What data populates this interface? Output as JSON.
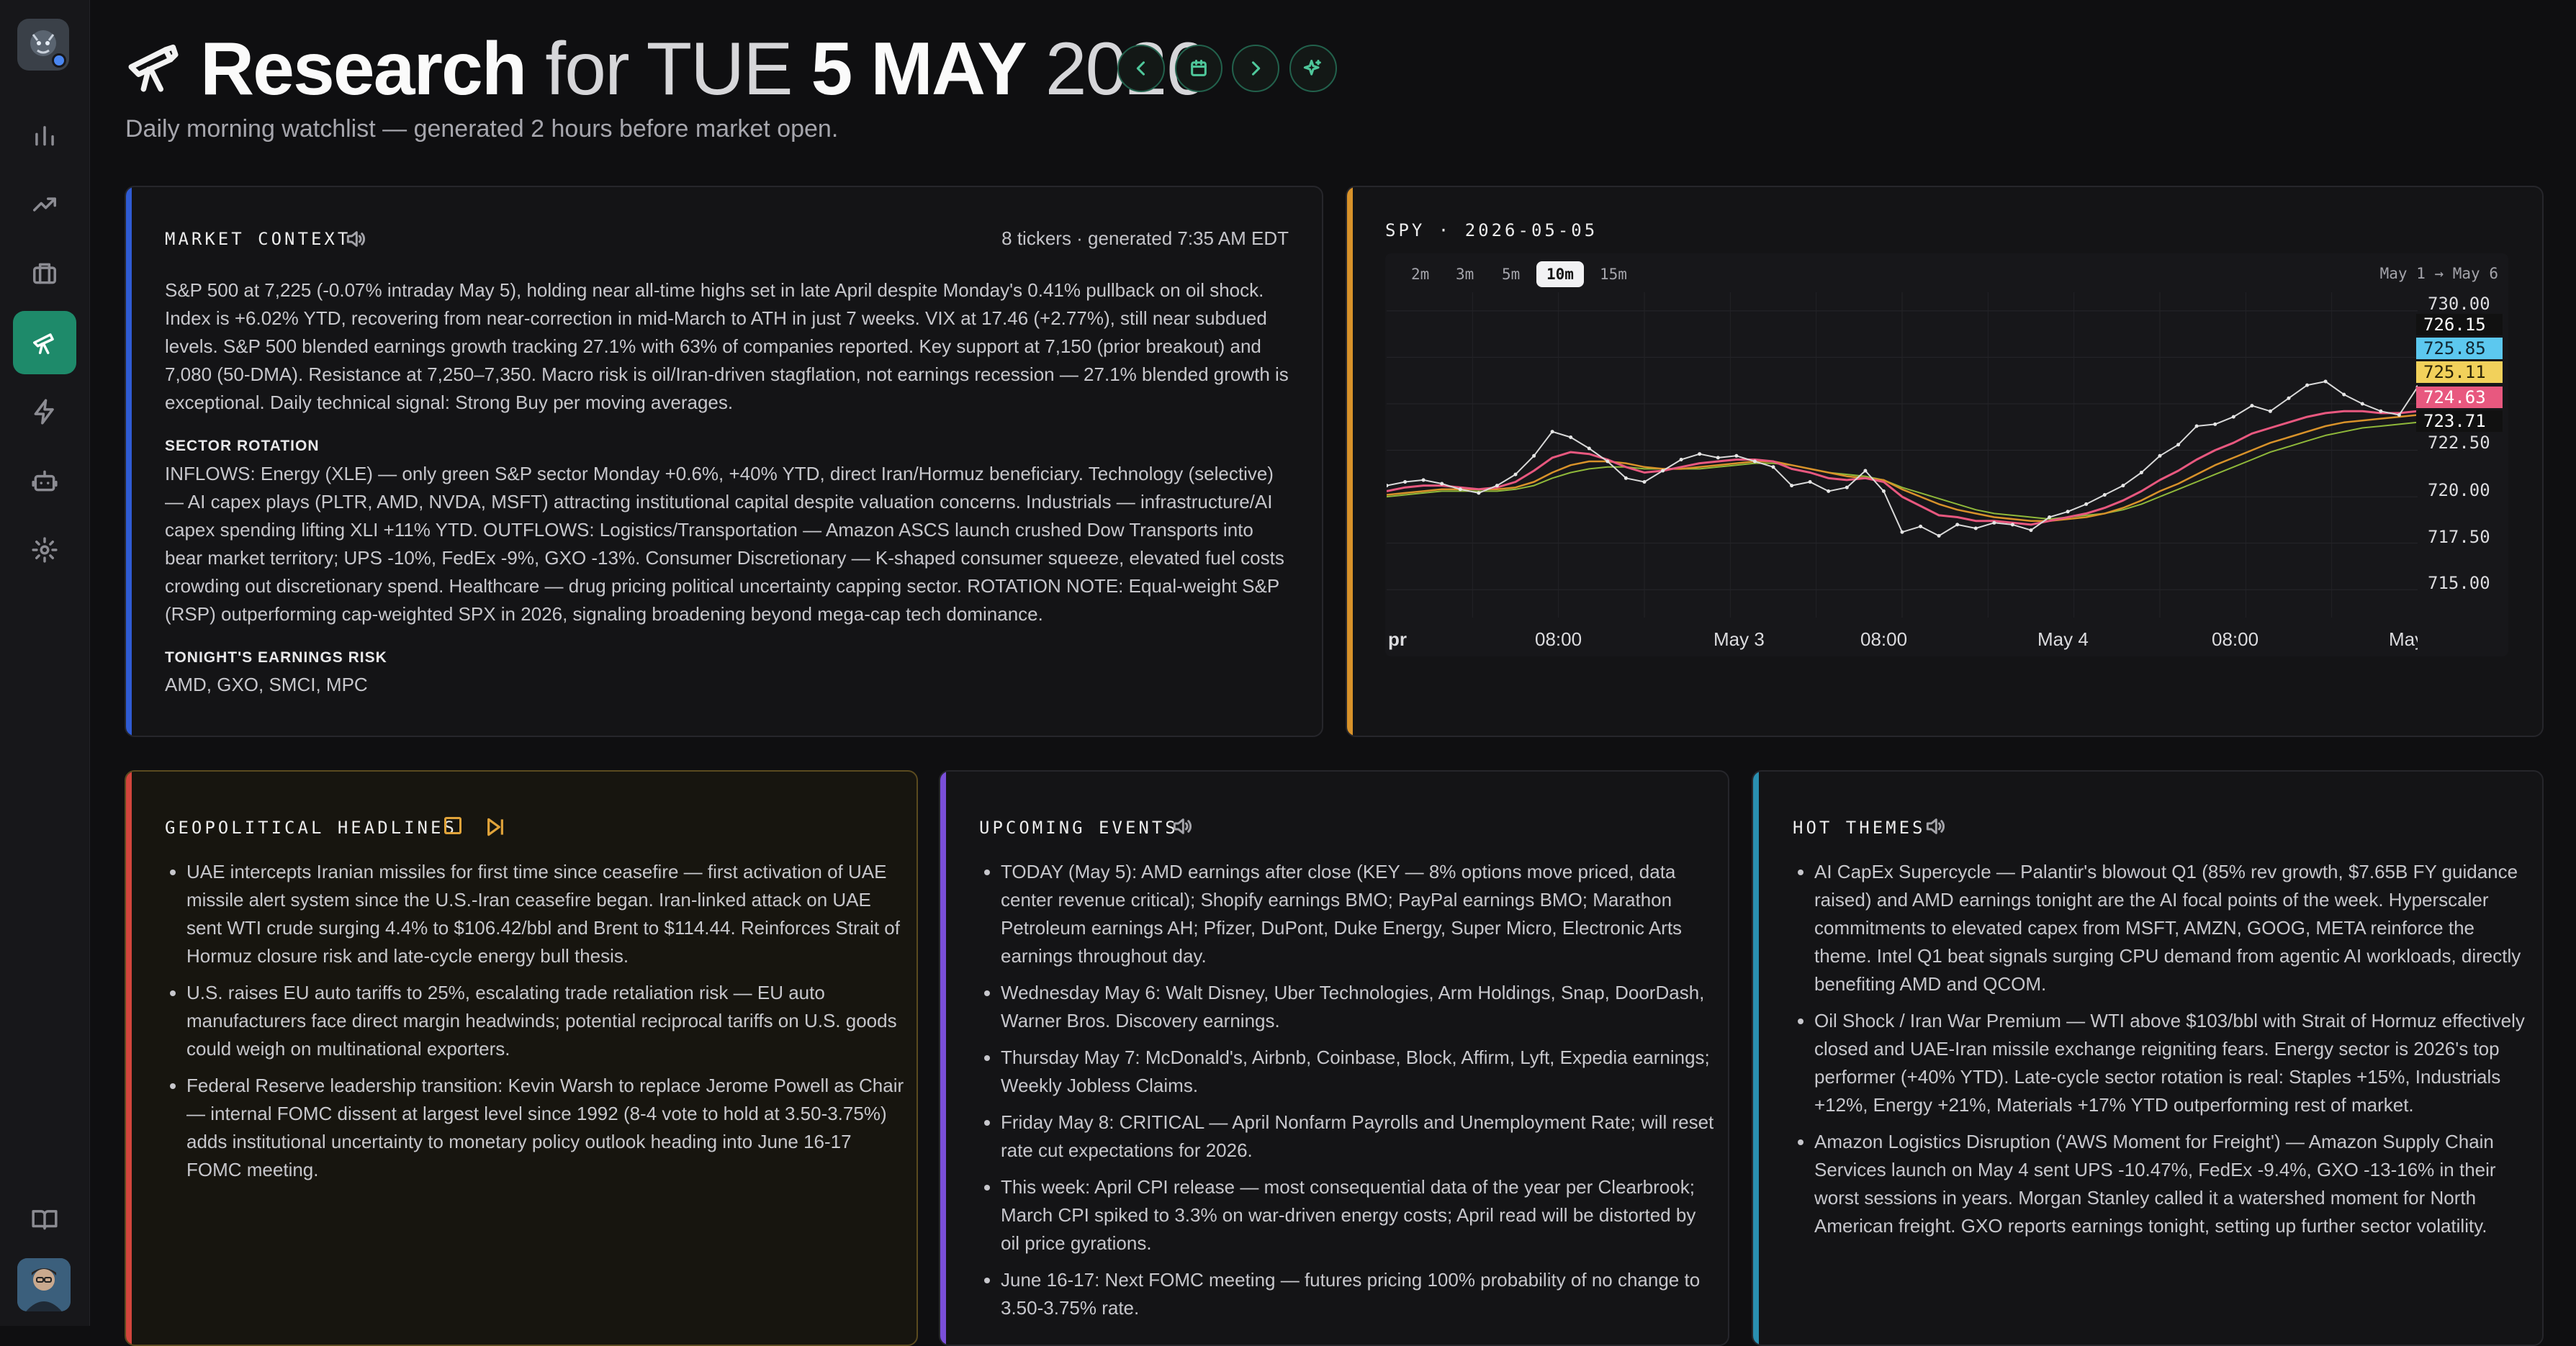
{
  "header": {
    "title_main": "Research",
    "title_for": "for",
    "date_dow": "TUE",
    "date_day_month": "5 MAY",
    "date_year": "2026",
    "subtitle": "Daily morning watchlist — generated 2 hours before market open."
  },
  "market_context": {
    "title": "MARKET CONTEXT",
    "meta": "8 tickers · generated 7:35 AM EDT",
    "body": "S&P 500 at 7,225 (-0.07% intraday May 5), holding near all-time highs set in late April despite Monday's 0.41% pullback on oil shock. Index is +6.02% YTD, recovering from near-correction in mid-March to ATH in just 7 weeks. VIX at 17.46 (+2.77%), still near subdued levels. S&P 500 blended earnings growth tracking 27.1% with 63% of companies reported. Key support at 7,150 (prior breakout) and 7,080 (50-DMA). Resistance at 7,250–7,350. Macro risk is oil/Iran-driven stagflation, not earnings recession — 27.1% blended growth is exceptional. Daily technical signal: Strong Buy per moving averages.",
    "sector_heading": "SECTOR ROTATION",
    "sector_body": "INFLOWS: Energy (XLE) — only green S&P sector Monday +0.6%, +40% YTD, direct Iran/Hormuz beneficiary. Technology (selective) — AI capex plays (PLTR, AMD, NVDA, MSFT) attracting institutional capital despite valuation concerns. Industrials — infrastructure/AI capex spending lifting XLI +11% YTD. OUTFLOWS: Logistics/Transportation — Amazon ASCS launch crushed Dow Transports into bear market territory; UPS -10%, FedEx -9%, GXO -13%. Consumer Discretionary — K-shaped consumer squeeze, elevated fuel costs crowding out discretionary spend. Healthcare — drug pricing political uncertainty capping sector. ROTATION NOTE: Equal-weight S&P (RSP) outperforming cap-weighted SPX in 2026, signaling broadening beyond mega-cap tech dominance.",
    "earnings_heading": "TONIGHT'S EARNINGS RISK",
    "earnings_body": "AMD, GXO, SMCI, MPC"
  },
  "chart_panel": {
    "title": "SPY · 2026-05-05",
    "timeframes": [
      "2m",
      "3m",
      "5m",
      "10m",
      "15m"
    ],
    "active_timeframe": "10m",
    "range_label": "May 1 → May 6"
  },
  "chart_data": {
    "type": "line",
    "symbol": "SPY",
    "x_ticks": [
      "pr",
      "08:00",
      "May 3",
      "08:00",
      "May 4",
      "08:00",
      "May"
    ],
    "y_ticks": [
      "730.00",
      "722.50",
      "720.00",
      "717.50",
      "715.00"
    ],
    "ylim": [
      713.5,
      731
    ],
    "price_labels": [
      {
        "value": "726.15",
        "color": "#111111"
      },
      {
        "value": "725.85",
        "color": "#5cc8ef"
      },
      {
        "value": "725.11",
        "color": "#f2d15b"
      },
      {
        "value": "724.63",
        "color": "#e8587f"
      },
      {
        "value": "723.71",
        "color": "#111111"
      }
    ],
    "series": [
      {
        "values": [
          720.6,
          720.8,
          720.9,
          720.7,
          720.4,
          720.2,
          720.6,
          721.2,
          722.2,
          723.5,
          723.2,
          722.6,
          721.9,
          721.0,
          720.8,
          721.4,
          722.0,
          722.3,
          722.1,
          722.2,
          721.9,
          721.6,
          720.6,
          720.8,
          720.3,
          720.5,
          721.4,
          720.3,
          718.1,
          718.4,
          717.9,
          718.5,
          718.3,
          718.6,
          718.5,
          718.2,
          718.9,
          719.2,
          719.6,
          720.1,
          720.6,
          721.3,
          722.2,
          722.8,
          723.8,
          723.9,
          724.3,
          724.9,
          724.6,
          725.3,
          726.0,
          726.2,
          725.5,
          725.0,
          724.6,
          724.4,
          725.9
        ]
      },
      {
        "values": [
          720.3,
          720.5,
          720.6,
          720.6,
          720.5,
          720.4,
          720.5,
          720.8,
          721.4,
          722.1,
          722.4,
          722.3,
          722.0,
          721.6,
          721.3,
          721.4,
          721.6,
          721.8,
          721.9,
          722.0,
          722.0,
          721.9,
          721.5,
          721.3,
          721.0,
          720.9,
          721.0,
          720.8,
          720.0,
          719.5,
          719.0,
          718.9,
          718.7,
          718.7,
          718.6,
          718.5,
          718.7,
          718.9,
          719.1,
          719.4,
          719.8,
          720.3,
          720.9,
          721.4,
          722.0,
          722.5,
          722.9,
          723.4,
          723.7,
          724.0,
          724.3,
          724.5,
          724.6,
          724.6,
          724.5,
          724.5,
          724.6
        ]
      },
      {
        "values": [
          720.1,
          720.2,
          720.3,
          720.4,
          720.4,
          720.4,
          720.4,
          720.5,
          720.8,
          721.3,
          721.7,
          721.9,
          721.9,
          721.8,
          721.6,
          721.5,
          721.5,
          721.6,
          721.7,
          721.8,
          721.9,
          721.9,
          721.7,
          721.5,
          721.3,
          721.1,
          721.0,
          720.9,
          720.4,
          720.0,
          719.6,
          719.3,
          719.1,
          718.9,
          718.8,
          718.7,
          718.7,
          718.8,
          718.9,
          719.1,
          719.4,
          719.8,
          720.3,
          720.7,
          721.2,
          721.7,
          722.1,
          722.5,
          722.9,
          723.2,
          723.5,
          723.8,
          724.0,
          724.1,
          724.2,
          724.3,
          724.4
        ]
      },
      {
        "values": [
          720.0,
          720.1,
          720.2,
          720.3,
          720.3,
          720.3,
          720.3,
          720.4,
          720.6,
          721.0,
          721.3,
          721.5,
          721.6,
          721.6,
          721.5,
          721.5,
          721.5,
          721.5,
          721.6,
          721.7,
          721.8,
          721.8,
          721.7,
          721.5,
          721.3,
          721.2,
          721.1,
          720.9,
          720.5,
          720.2,
          719.9,
          719.6,
          719.3,
          719.1,
          719.0,
          718.9,
          718.8,
          718.9,
          719.0,
          719.1,
          719.3,
          719.6,
          720.0,
          720.4,
          720.8,
          721.2,
          721.6,
          722.0,
          722.4,
          722.7,
          723.0,
          723.3,
          723.5,
          723.7,
          723.8,
          723.9,
          724.0
        ]
      }
    ]
  },
  "geopolitical": {
    "title": "GEOPOLITICAL HEADLINES",
    "items": [
      "UAE intercepts Iranian missiles for first time since ceasefire — first activation of UAE missile alert system since the U.S.-Iran ceasefire began. Iran-linked attack on UAE sent WTI crude surging 4.4% to $106.42/bbl and Brent to $114.44. Reinforces Strait of Hormuz closure risk and late-cycle energy bull thesis.",
      "U.S. raises EU auto tariffs to 25%, escalating trade retaliation risk — EU auto manufacturers face direct margin headwinds; potential reciprocal tariffs on U.S. goods could weigh on multinational exporters.",
      "Federal Reserve leadership transition: Kevin Warsh to replace Jerome Powell as Chair — internal FOMC dissent at largest level since 1992 (8-4 vote to hold at 3.50-3.75%) adds institutional uncertainty to monetary policy outlook heading into June 16-17 FOMC meeting."
    ]
  },
  "events": {
    "title": "UPCOMING EVENTS",
    "items": [
      "TODAY (May 5): AMD earnings after close (KEY — 8% options move priced, data center revenue critical); Shopify earnings BMO; PayPal earnings BMO; Marathon Petroleum earnings AH; Pfizer, DuPont, Duke Energy, Super Micro, Electronic Arts earnings throughout day.",
      "Wednesday May 6: Walt Disney, Uber Technologies, Arm Holdings, Snap, DoorDash, Warner Bros. Discovery earnings.",
      "Thursday May 7: McDonald's, Airbnb, Coinbase, Block, Affirm, Lyft, Expedia earnings; Weekly Jobless Claims.",
      "Friday May 8: CRITICAL — April Nonfarm Payrolls and Unemployment Rate; will reset rate cut expectations for 2026.",
      "This week: April CPI release — most consequential data of the year per Clearbrook; March CPI spiked to 3.3% on war-driven energy costs; April read will be distorted by oil price gyrations.",
      "June 16-17: Next FOMC meeting — futures pricing 100% probability of no change to 3.50-3.75% rate."
    ]
  },
  "themes": {
    "title": "HOT THEMES",
    "items": [
      "AI CapEx Supercycle — Palantir's blowout Q1 (85% rev growth, $7.65B FY guidance raised) and AMD earnings tonight are the AI focal points of the week. Hyperscaler commitments to elevated capex from MSFT, AMZN, GOOG, META reinforce the theme. Intel Q1 beat signals surging CPU demand from agentic AI workloads, directly benefiting AMD and QCOM.",
      "Oil Shock / Iran War Premium — WTI above $103/bbl with Strait of Hormuz effectively closed and UAE-Iran missile exchange reigniting fears. Energy sector is 2026's top performer (+40% YTD). Late-cycle sector rotation is real: Staples +15%, Industrials +12%, Energy +21%, Materials +17% YTD outperforming rest of market.",
      "Amazon Logistics Disruption ('AWS Moment for Freight') — Amazon Supply Chain Services launch on May 4 sent UPS -10.47%, FedEx -9.4%, GXO -13-16% in their worst sessions in years. Morgan Stanley called it a watershed moment for North American freight. GXO reports earnings tonight, setting up further sector volatility."
    ]
  },
  "colors": {
    "accent_green": "#1e8a6a",
    "market_context_accent": "#2f5bd3",
    "chart_accent": "#d8922a",
    "geo_accent": "#d2453c",
    "events_accent": "#7a4fd9",
    "themes_accent": "#2a8fb0",
    "price_line": "#d9d9d9",
    "ma1": "#e8587f",
    "ma2": "#d8922a",
    "ma3": "#8fb83a"
  }
}
